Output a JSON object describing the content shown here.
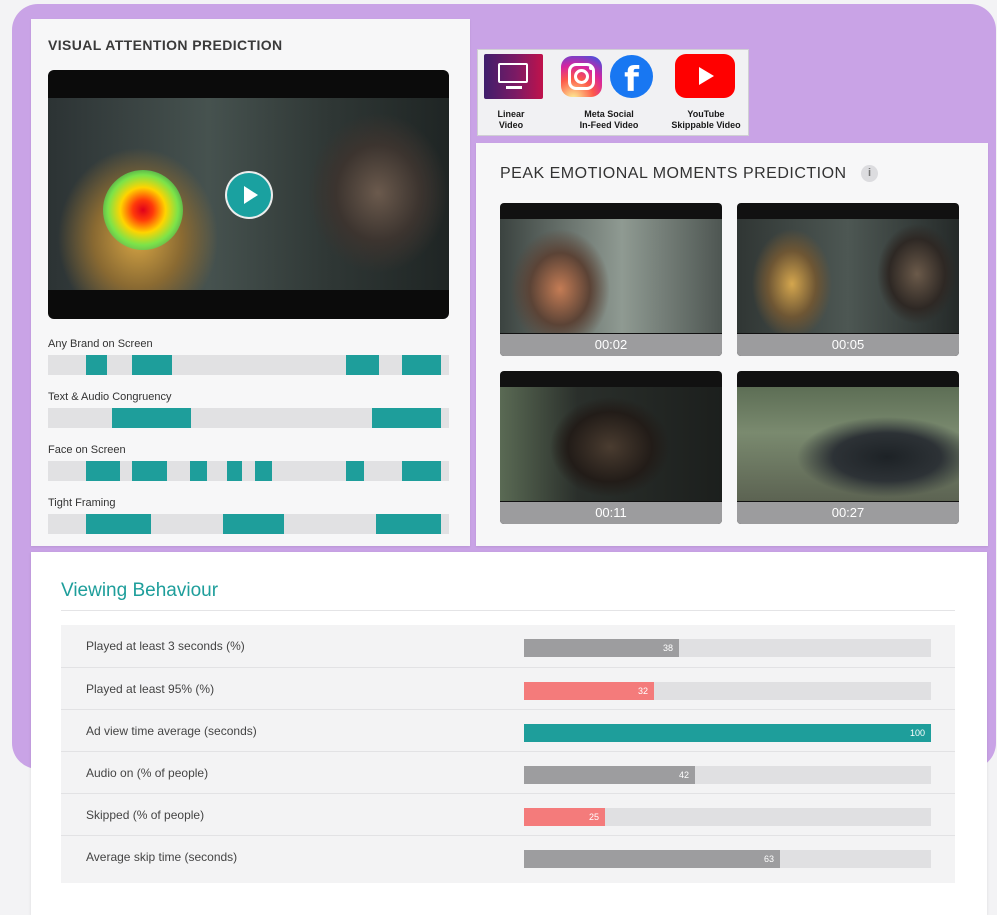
{
  "attention": {
    "title": "VISUAL ATTENTION PREDICTION",
    "tracks": [
      {
        "label": "Any Brand on Screen",
        "segments": [
          [
            0.095,
            0.147
          ],
          [
            0.209,
            0.309
          ],
          [
            0.743,
            0.825
          ],
          [
            0.883,
            0.98
          ]
        ]
      },
      {
        "label": "Text & Audio Congruency",
        "segments": [
          [
            0.16,
            0.357
          ],
          [
            0.808,
            0.98
          ]
        ]
      },
      {
        "label": "Face on Screen",
        "segments": [
          [
            0.095,
            0.181
          ],
          [
            0.209,
            0.297
          ],
          [
            0.354,
            0.397
          ],
          [
            0.447,
            0.484
          ],
          [
            0.517,
            0.56
          ],
          [
            0.743,
            0.788
          ],
          [
            0.883,
            0.98
          ]
        ]
      },
      {
        "label": "Tight Framing",
        "segments": [
          [
            0.095,
            0.257
          ],
          [
            0.436,
            0.589
          ],
          [
            0.819,
            0.98
          ]
        ]
      }
    ]
  },
  "platforms": [
    {
      "name_line1": "Linear",
      "name_line2": "Video",
      "icon": "tv-icon"
    },
    {
      "name_line1": "Meta Social",
      "name_line2": "In-Feed Video",
      "icon": "instagram-facebook-icons"
    },
    {
      "name_line1": "YouTube",
      "name_line2": "Skippable Video",
      "icon": "youtube-icon"
    }
  ],
  "facebook_glyph": "f",
  "peak": {
    "title": "PEAK EMOTIONAL MOMENTS PREDICTION",
    "info_glyph": "i",
    "moments": [
      "00:02",
      "00:05",
      "00:11",
      "00:27"
    ]
  },
  "viewing": {
    "title": "Viewing Behaviour",
    "colors": {
      "neutral": "#9d9d9f",
      "negative": "#f47b7b",
      "positive": "#1e9e9b"
    },
    "rows": [
      {
        "label": "Played at least 3 seconds (%)",
        "value": "38",
        "fill": 0.38,
        "tone": "neutral"
      },
      {
        "label": "Played at least 95% (%)",
        "value": "32",
        "fill": 0.32,
        "tone": "negative"
      },
      {
        "label": "Ad view time average (seconds)",
        "value": "100",
        "fill": 1.0,
        "tone": "positive"
      },
      {
        "label": "Audio on (% of people)",
        "value": "42",
        "fill": 0.42,
        "tone": "neutral"
      },
      {
        "label": "Skipped (% of people)",
        "value": "25",
        "fill": 0.2,
        "tone": "negative"
      },
      {
        "label": "Average skip time (seconds)",
        "value": "63",
        "fill": 0.63,
        "tone": "neutral"
      }
    ]
  }
}
